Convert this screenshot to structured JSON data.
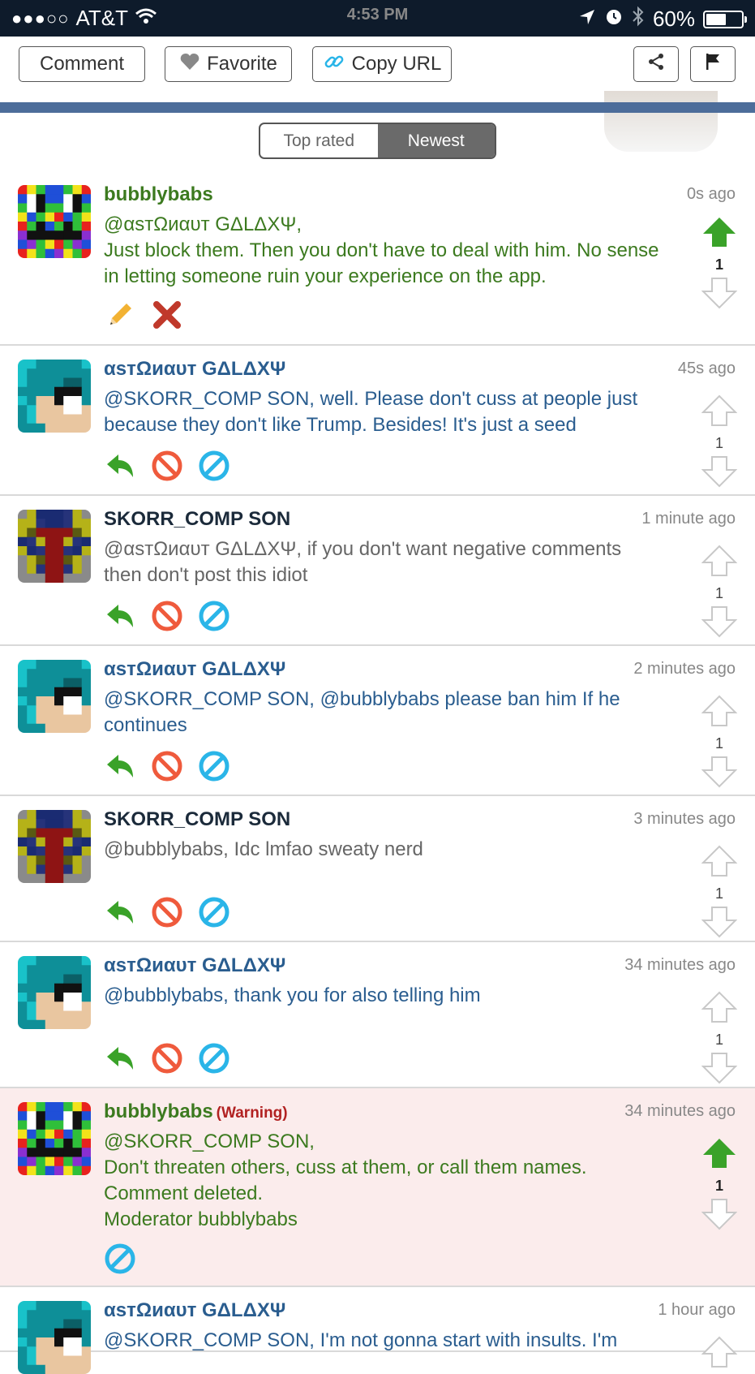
{
  "status_bar": {
    "signal": "●●●○○",
    "carrier": "AT&T",
    "time": "4:53 PM",
    "battery": "60%",
    "battery_level": 0.6
  },
  "toolbar": {
    "comment_label": "Comment",
    "favorite_label": "Favorite",
    "copy_url_label": "Copy URL"
  },
  "tabs": {
    "top_rated": "Top rated",
    "newest": "Newest",
    "active": "Newest"
  },
  "colors": {
    "moderator_name": "#3c7a1f",
    "user_name_blue": "#2a5d8f",
    "user_name_dark": "#1b2a3a",
    "warning_bg": "#fbecec",
    "upvote_active": "#3aa229",
    "reply_icon": "#3aa229",
    "block_icon": "#ef5a3c",
    "ban_icon": "#2ab5e8"
  },
  "comments": [
    {
      "user": "bubblybabs",
      "time": "0s ago",
      "lines": [
        "@αѕтΩиαυт GΔLΔXΨ,",
        "Just block them. Then you don't have to deal with him. No sense in letting someone ruin your experience on the app."
      ],
      "votes": "1",
      "actions": [
        "edit-icon",
        "delete-icon"
      ]
    },
    {
      "user": "αѕтΩиαυт GΔLΔXΨ",
      "time": "45s ago",
      "lines": [
        "@SKORR_COMP SON, well. Please don't cuss at people just because they don't like Trump. Besides! It's just a seed"
      ],
      "votes": "1",
      "actions": [
        "reply-icon",
        "block-icon",
        "ban-icon"
      ]
    },
    {
      "user": "SKORR_COMP SON",
      "time": "1 minute ago",
      "lines": [
        "@αѕтΩиαυт GΔLΔXΨ, if you don't want negative comments then don't post this idiot"
      ],
      "votes": "1",
      "actions": [
        "reply-icon",
        "block-icon",
        "ban-icon"
      ]
    },
    {
      "user": "αѕтΩиαυт GΔLΔXΨ",
      "time": "2 minutes ago",
      "lines": [
        "@SKORR_COMP SON, @bubblybabs please ban him If he continues"
      ],
      "votes": "1",
      "actions": [
        "reply-icon",
        "block-icon",
        "ban-icon"
      ]
    },
    {
      "user": "SKORR_COMP SON",
      "time": "3 minutes ago",
      "lines": [
        "@bubblybabs, Idc lmfao sweaty nerd"
      ],
      "votes": "1",
      "actions": [
        "reply-icon",
        "block-icon",
        "ban-icon"
      ]
    },
    {
      "user": "αѕтΩиαυт GΔLΔXΨ",
      "time": "34 minutes ago",
      "lines": [
        "@bubblybabs, thank you for also telling him"
      ],
      "votes": "1",
      "actions": [
        "reply-icon",
        "block-icon",
        "ban-icon"
      ]
    },
    {
      "user": "bubblybabs",
      "warning": "(Warning)",
      "time": "34 minutes ago",
      "lines": [
        "@SKORR_COMP SON,",
        "Don't threaten others, cuss at them, or call them names.",
        "Comment deleted.",
        "Moderator bubblybabs"
      ],
      "votes": "1",
      "actions": [
        "ban-icon"
      ]
    },
    {
      "user": "αѕтΩиαυт GΔLΔXΨ",
      "time": "1 hour ago",
      "lines": [
        "@SKORR_COMP SON, I'm not gonna start with insults. I'm"
      ],
      "votes": "",
      "actions": []
    }
  ]
}
